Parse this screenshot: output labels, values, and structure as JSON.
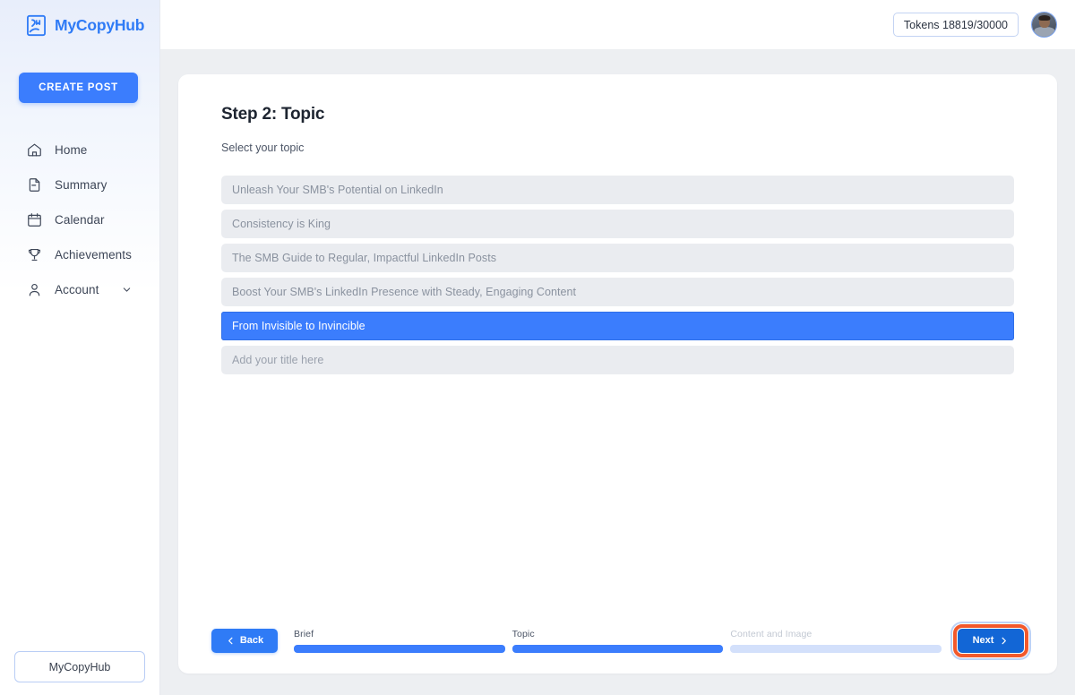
{
  "brand": {
    "name": "MyCopyHub",
    "logo_icon": "book-logo-icon",
    "accent_color": "#3b7dfd"
  },
  "sidebar": {
    "create_post_label": "CREATE POST",
    "footer_button_label": "MyCopyHub",
    "items": [
      {
        "label": "Home",
        "icon": "home-icon"
      },
      {
        "label": "Summary",
        "icon": "document-icon"
      },
      {
        "label": "Calendar",
        "icon": "calendar-icon"
      },
      {
        "label": "Achievements",
        "icon": "trophy-icon"
      },
      {
        "label": "Account",
        "icon": "user-icon",
        "chevron": "chevron-down-icon"
      }
    ]
  },
  "topbar": {
    "tokens_label": "Tokens 18819/30000",
    "avatar_icon": "user-avatar"
  },
  "main": {
    "title": "Step 2: Topic",
    "subtitle": "Select your topic",
    "topics": [
      {
        "text": "Unleash Your SMB's Potential on LinkedIn",
        "selected": false,
        "is_input": false
      },
      {
        "text": "Consistency is King",
        "selected": false,
        "is_input": false
      },
      {
        "text": "The SMB Guide to Regular, Impactful LinkedIn Posts",
        "selected": false,
        "is_input": false
      },
      {
        "text": "Boost Your SMB's LinkedIn Presence with Steady, Engaging Content",
        "selected": false,
        "is_input": false
      },
      {
        "text": "From Invisible to Invincible",
        "selected": true,
        "is_input": false
      },
      {
        "text": "Add your title here",
        "selected": false,
        "is_input": true
      }
    ]
  },
  "bottombar": {
    "back_label": "Back",
    "back_icon": "chevron-left-icon",
    "next_label": "Next",
    "next_icon": "chevron-right-icon",
    "next_highlight_color": "#f2592c",
    "steps": [
      {
        "label": "Brief",
        "active": true
      },
      {
        "label": "Topic",
        "active": true
      },
      {
        "label": "Content and Image",
        "active": false
      }
    ]
  }
}
